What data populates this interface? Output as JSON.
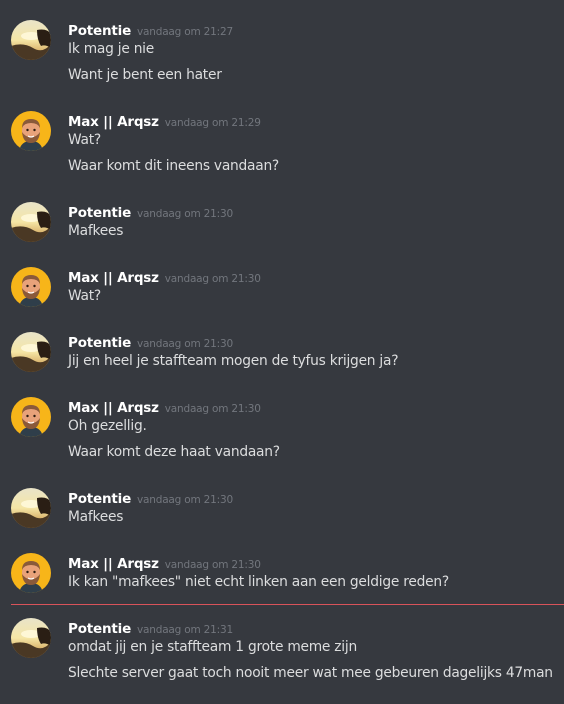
{
  "users": {
    "potentie": {
      "name": "Potentie"
    },
    "max": {
      "name": "Max || Arqsz"
    }
  },
  "messages": [
    {
      "author": "Potentie",
      "timestamp": "vandaag om 21:27",
      "lines": [
        "Ik mag je nie",
        "Want je bent een hater"
      ]
    },
    {
      "author": "Max || Arqsz",
      "timestamp": "vandaag om 21:29",
      "lines": [
        "Wat?",
        "Waar komt dit ineens vandaan?"
      ]
    },
    {
      "author": "Potentie",
      "timestamp": "vandaag om 21:30",
      "lines": [
        "Mafkees"
      ]
    },
    {
      "author": "Max || Arqsz",
      "timestamp": "vandaag om 21:30",
      "lines": [
        "Wat?"
      ]
    },
    {
      "author": "Potentie",
      "timestamp": "vandaag om 21:30",
      "lines": [
        "Jij en heel je staffteam mogen de tyfus krijgen ja?"
      ]
    },
    {
      "author": "Max || Arqsz",
      "timestamp": "vandaag om 21:30",
      "lines": [
        "Oh gezellig.",
        "Waar komt deze haat vandaan?"
      ]
    },
    {
      "author": "Potentie",
      "timestamp": "vandaag om 21:30",
      "lines": [
        "Mafkees"
      ]
    },
    {
      "author": "Max || Arqsz",
      "timestamp": "vandaag om 21:30",
      "lines": [
        "Ik kan \"mafkees\" niet echt linken aan een geldige reden?"
      ]
    },
    {
      "author": "Potentie",
      "timestamp": "vandaag om 21:31",
      "lines": [
        "omdat jij en je staffteam 1 grote meme zijn",
        "Slechte server gaat toch nooit meer wat mee gebeuren dagelijks 47man"
      ]
    }
  ],
  "colors": {
    "background": "#36393f",
    "username": "#ffffff",
    "text": "#dcddde",
    "timestamp": "#72767d",
    "new_divider": "#d9535a"
  },
  "icons": {
    "potentie_avatar": "sunset-avatar-icon",
    "max_avatar": "bearded-man-avatar-icon"
  }
}
